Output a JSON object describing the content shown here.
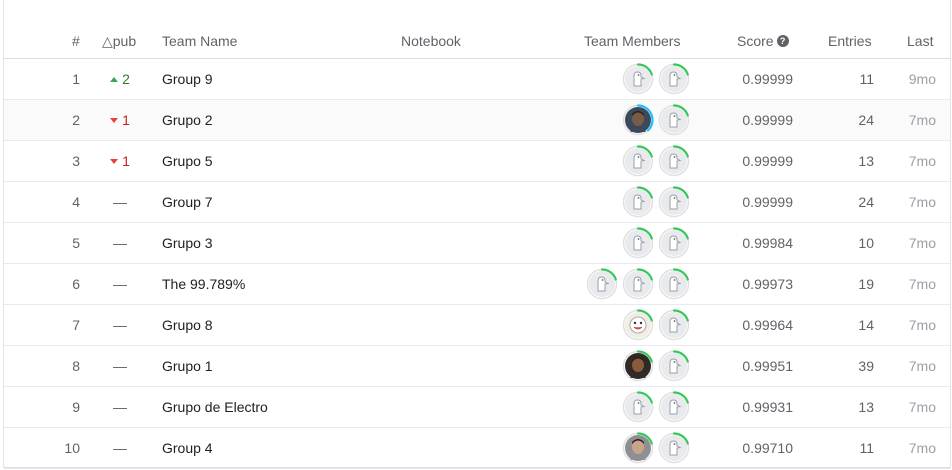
{
  "header": {
    "rank": "#",
    "delta": "△pub",
    "team_name": "Team Name",
    "notebook": "Notebook",
    "team_members": "Team Members",
    "score": "Score",
    "entries": "Entries",
    "last": "Last"
  },
  "colors": {
    "progress_green": "#20beff",
    "progress_done": "#34c759",
    "up": "#34a853",
    "down": "#ea4335"
  },
  "rows": [
    {
      "rank": "1",
      "delta": "2",
      "delta_dir": "up",
      "team": "Group 9",
      "score": "0.99999",
      "entries": "11",
      "last": "9mo",
      "members": [
        "goose",
        "goose"
      ]
    },
    {
      "rank": "2",
      "delta": "1",
      "delta_dir": "down",
      "team": "Grupo 2",
      "score": "0.99999",
      "entries": "24",
      "last": "7mo",
      "members": [
        "photo-man-blue",
        "goose"
      ]
    },
    {
      "rank": "3",
      "delta": "1",
      "delta_dir": "down",
      "team": "Grupo 5",
      "score": "0.99999",
      "entries": "13",
      "last": "7mo",
      "members": [
        "goose",
        "goose"
      ]
    },
    {
      "rank": "4",
      "delta": "—",
      "delta_dir": "none",
      "team": "Group 7",
      "score": "0.99999",
      "entries": "24",
      "last": "7mo",
      "members": [
        "goose",
        "goose"
      ]
    },
    {
      "rank": "5",
      "delta": "—",
      "delta_dir": "none",
      "team": "Grupo 3",
      "score": "0.99984",
      "entries": "10",
      "last": "7mo",
      "members": [
        "goose",
        "goose"
      ]
    },
    {
      "rank": "6",
      "delta": "—",
      "delta_dir": "none",
      "team": "The 99.789%",
      "score": "0.99973",
      "entries": "19",
      "last": "7mo",
      "members": [
        "goose",
        "goose",
        "goose"
      ]
    },
    {
      "rank": "7",
      "delta": "—",
      "delta_dir": "none",
      "team": "Grupo 8",
      "score": "0.99964",
      "entries": "14",
      "last": "7mo",
      "members": [
        "cartoon-face",
        "goose"
      ]
    },
    {
      "rank": "8",
      "delta": "—",
      "delta_dir": "none",
      "team": "Grupo 1",
      "score": "0.99951",
      "entries": "39",
      "last": "7mo",
      "members": [
        "photo-man-dark",
        "goose"
      ]
    },
    {
      "rank": "9",
      "delta": "—",
      "delta_dir": "none",
      "team": "Grupo de Electro",
      "score": "0.99931",
      "entries": "13",
      "last": "7mo",
      "members": [
        "goose",
        "goose"
      ]
    },
    {
      "rank": "10",
      "delta": "—",
      "delta_dir": "none",
      "team": "Group 4",
      "score": "0.99710",
      "entries": "11",
      "last": "7mo",
      "members": [
        "photo-man-light",
        "goose"
      ]
    }
  ]
}
